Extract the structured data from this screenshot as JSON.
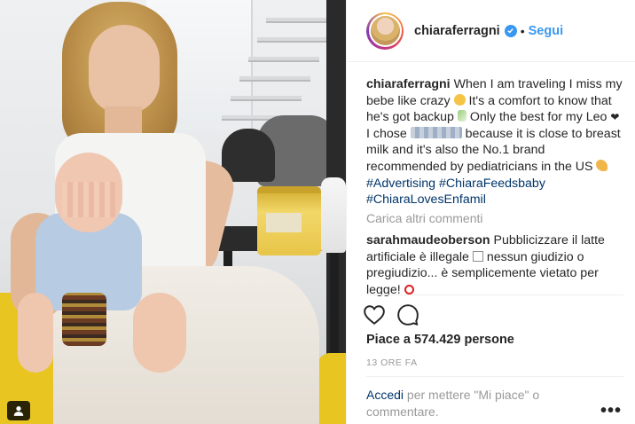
{
  "header": {
    "username": "chiaraferragni",
    "separator": "•",
    "follow_label": "Segui"
  },
  "caption": {
    "username": "chiaraferragni",
    "text_1": "When I am traveling I miss my bebe like crazy",
    "text_2": "It's a comfort to know that he's got backup",
    "text_3": "Only the best for my Leo",
    "text_4": "I chose",
    "text_5": "because it is close to breast milk and it's also the No.1 brand recommended by pediatricians in the US",
    "hashtags": [
      "#Advertising",
      "#ChiaraFeedsbaby",
      "#ChiaraLovesEnfamil"
    ]
  },
  "load_more": "Carica altri commenti",
  "comment": {
    "username": "sarahmaudeoberson",
    "text_1": "Pubblicizzare il latte artificiale è illegale",
    "text_2": "nessun giudizio o pregiudizio... è semplicemente vietato per legge!"
  },
  "likes": "Piace a 574.429 persone",
  "timestamp": "13 ORE FA",
  "login": {
    "link": "Accedi",
    "text": "per mettere \"Mi piace\" o commentare."
  },
  "more_options": "•••",
  "icons": {
    "verified": "verified-badge-icon",
    "like": "heart-outline-icon",
    "comment": "speech-bubble-icon",
    "user_tag": "person-icon",
    "more": "ellipsis-icon"
  },
  "colors": {
    "link_blue": "#3897f0",
    "hashtag_blue": "#003569",
    "muted_gray": "#999999",
    "text": "#262626"
  }
}
